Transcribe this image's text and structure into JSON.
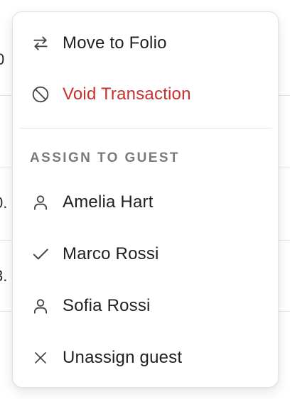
{
  "background": {
    "fragments": [
      "0",
      "0.",
      "3."
    ]
  },
  "menu": {
    "actions": [
      {
        "label": "Move to Folio",
        "icon": "arrows-left-right-icon"
      },
      {
        "label": "Void Transaction",
        "icon": "ban-icon",
        "color": "#c8302c"
      }
    ],
    "section_title": "ASSIGN TO GUEST",
    "guests": [
      {
        "label": "Amelia Hart",
        "icon": "user-icon",
        "selected": false
      },
      {
        "label": "Marco Rossi",
        "icon": "check-icon",
        "selected": true
      },
      {
        "label": "Sofia Rossi",
        "icon": "user-icon",
        "selected": false
      }
    ],
    "unassign": {
      "label": "Unassign guest",
      "icon": "x-icon"
    }
  }
}
